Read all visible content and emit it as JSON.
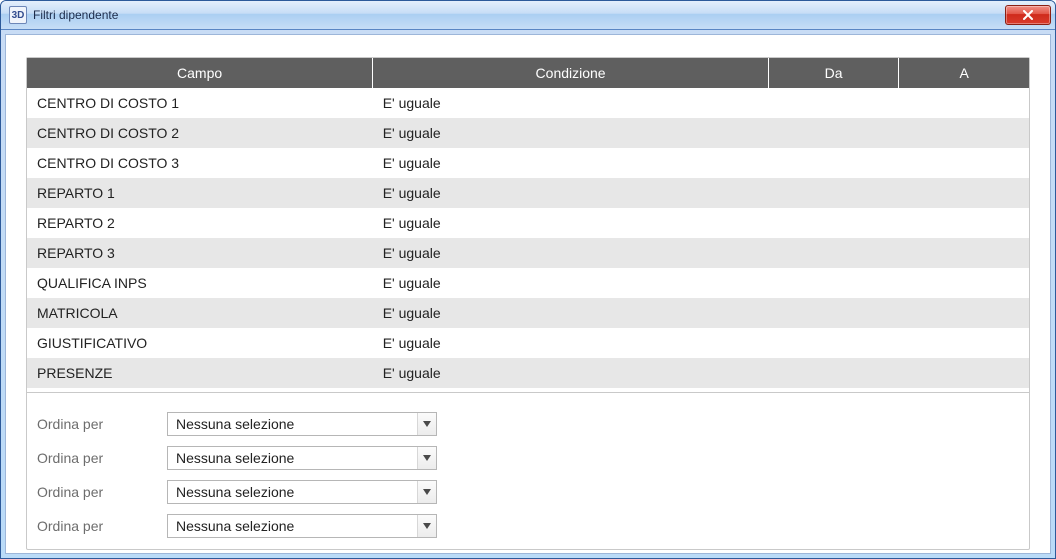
{
  "window": {
    "title": "Filtri dipendente",
    "app_icon_text": "3D"
  },
  "table": {
    "headers": {
      "campo": "Campo",
      "condizione": "Condizione",
      "da": "Da",
      "a": "A"
    },
    "rows": [
      {
        "campo": "CENTRO DI COSTO 1",
        "condizione": "E' uguale",
        "da": "",
        "a": ""
      },
      {
        "campo": "CENTRO DI COSTO 2",
        "condizione": "E' uguale",
        "da": "",
        "a": ""
      },
      {
        "campo": "CENTRO DI COSTO 3",
        "condizione": "E' uguale",
        "da": "",
        "a": ""
      },
      {
        "campo": "REPARTO 1",
        "condizione": "E' uguale",
        "da": "",
        "a": ""
      },
      {
        "campo": "REPARTO 2",
        "condizione": "E' uguale",
        "da": "",
        "a": ""
      },
      {
        "campo": "REPARTO 3",
        "condizione": "E' uguale",
        "da": "",
        "a": ""
      },
      {
        "campo": "QUALIFICA INPS",
        "condizione": "E' uguale",
        "da": "",
        "a": ""
      },
      {
        "campo": "MATRICOLA",
        "condizione": "E' uguale",
        "da": "",
        "a": ""
      },
      {
        "campo": "GIUSTIFICATIVO",
        "condizione": "E' uguale",
        "da": "",
        "a": ""
      },
      {
        "campo": "PRESENZE",
        "condizione": "E' uguale",
        "da": "",
        "a": ""
      }
    ]
  },
  "sort": {
    "label": "Ordina per",
    "selections": [
      "Nessuna selezione",
      "Nessuna selezione",
      "Nessuna selezione",
      "Nessuna selezione"
    ]
  }
}
